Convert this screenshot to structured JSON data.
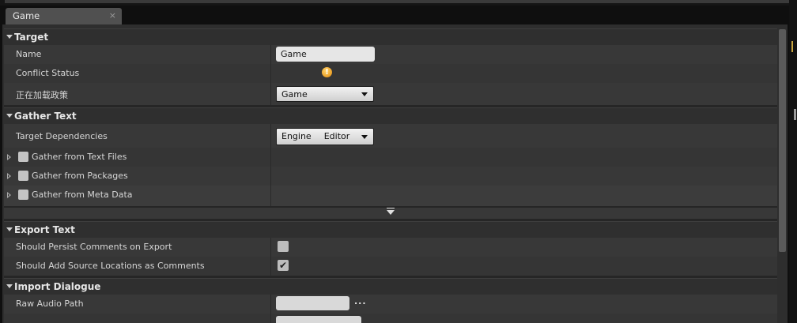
{
  "tab": {
    "label": "Game",
    "close": "×"
  },
  "sections": {
    "target": {
      "title": "Target",
      "name_label": "Name",
      "name_value": "Game",
      "conflict_label": "Conflict Status",
      "conflict_icon": "warning-icon",
      "loading_label": "正在加载政策",
      "loading_value": "Game"
    },
    "gather": {
      "title": "Gather Text",
      "deps_label": "Target Dependencies",
      "deps_value_1": "Engine",
      "deps_value_2": "Editor",
      "text_files": "Gather from Text Files",
      "packages": "Gather from Packages",
      "meta_data": "Gather from Meta Data"
    },
    "export": {
      "title": "Export Text",
      "persist_label": "Should Persist Comments on Export",
      "persist_checked": false,
      "source_label": "Should Add Source Locations as Comments",
      "source_checked": true,
      "check_glyph": "✔"
    },
    "import": {
      "title": "Import Dialogue",
      "raw_audio_label": "Raw Audio Path",
      "browse": "..."
    }
  },
  "colors": {
    "panel": "#2e2e2e",
    "row": "#383838",
    "accent_warning": "#f0a020"
  }
}
